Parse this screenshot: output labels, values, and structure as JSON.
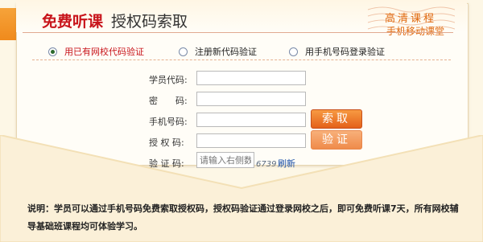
{
  "header": {
    "title_red": "免费听课",
    "title_black": "授权码索取",
    "tag_hd": "高清课程",
    "tag_mobile": "手机移动课堂"
  },
  "options": [
    {
      "label": "用已有网校代码验证",
      "selected": true
    },
    {
      "label": "注册新代码验证",
      "selected": false
    },
    {
      "label": "用手机号码登录验证",
      "selected": false
    }
  ],
  "form": {
    "student_code_label": "学员代码:",
    "password_label": "密　　码:",
    "phone_label": "手机号码:",
    "auth_code_label": "授 权 码:",
    "verify_code_label": "验 证 码:",
    "student_code_value": "",
    "password_value": "",
    "phone_value": "",
    "auth_code_value": "",
    "verify_code_placeholder": "请输入右侧数字",
    "captcha_text": "6739",
    "refresh_label": "刷新",
    "get_button": "索取",
    "verify_button": "验证"
  },
  "note": "说明：学员可以通过手机号码免费索取授权码，授权码验证通过登录网校之后，即可免费听课7天，所有网校辅导基础班课程均可体验学习。",
  "colors": {
    "brand_red": "#c8141b",
    "accent_orange": "#e4611a",
    "envelope_bg": "#fdf7e6"
  }
}
